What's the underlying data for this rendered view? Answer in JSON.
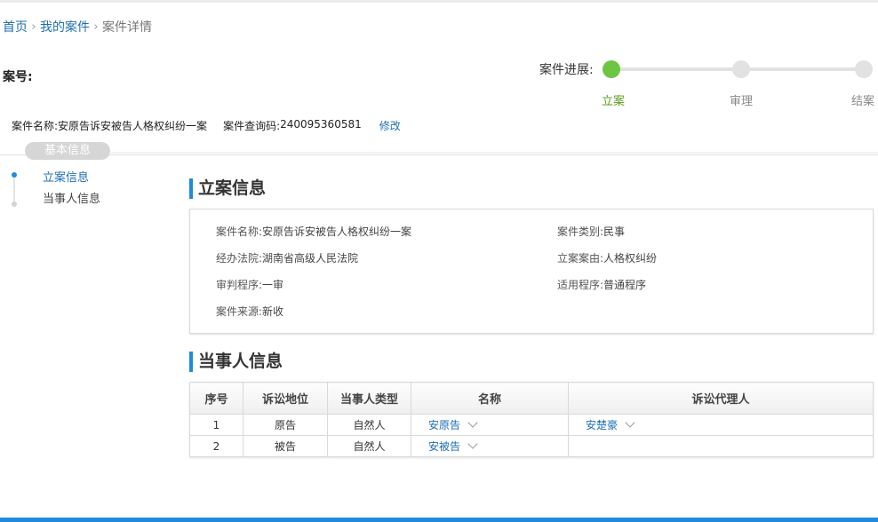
{
  "breadcrumb": {
    "home": "首页",
    "my_cases": "我的案件",
    "current": "案件详情"
  },
  "case_no_label": "案号:",
  "progress": {
    "label": "案件进展:",
    "steps": [
      {
        "label": "立案",
        "active": true
      },
      {
        "label": "审理",
        "active": false
      },
      {
        "label": "结案",
        "active": false
      }
    ]
  },
  "case_line": {
    "name_label": "案件名称:",
    "name_value": "安原告诉安被告人格权纠纷一案",
    "query_label": "案件查询码:",
    "query_value": "240095360581",
    "edit_link": "修改"
  },
  "tab": {
    "label": "基本信息"
  },
  "side_nav": {
    "items": [
      {
        "label": "立案信息",
        "active": true
      },
      {
        "label": "当事人信息",
        "active": false
      }
    ]
  },
  "filing": {
    "title": "立案信息",
    "fields": [
      {
        "label": "案件名称:",
        "value": "安原告诉安被告人格权纠纷一案"
      },
      {
        "label": "案件类别:",
        "value": "民事"
      },
      {
        "label": "经办法院:",
        "value": "湖南省高级人民法院"
      },
      {
        "label": "立案案由:",
        "value": "人格权纠纷"
      },
      {
        "label": "审判程序:",
        "value": "一审"
      },
      {
        "label": "适用程序:",
        "value": "普通程序"
      },
      {
        "label": "案件来源:",
        "value": "新收"
      }
    ]
  },
  "parties": {
    "title": "当事人信息",
    "headers": [
      "序号",
      "诉讼地位",
      "当事人类型",
      "名称",
      "诉讼代理人"
    ],
    "rows": [
      {
        "no": "1",
        "role": "原告",
        "type": "自然人",
        "name": "安原告",
        "agent": "安楚豪"
      },
      {
        "no": "2",
        "role": "被告",
        "type": "自然人",
        "name": "安被告",
        "agent": ""
      }
    ]
  },
  "colors": {
    "accent": "#1f8be0",
    "link": "#1f6fb2",
    "progress_active": "#6cc644"
  }
}
